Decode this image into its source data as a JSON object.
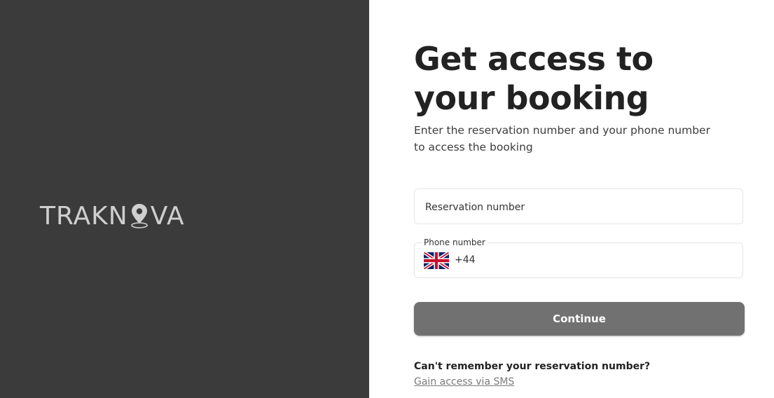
{
  "brand": {
    "logo_left": "TRAKN",
    "logo_right": "VA",
    "logo_color": "#cfcfcf",
    "panel_color": "#3b3b3b"
  },
  "main": {
    "title": "Get access to your booking",
    "subtitle": "Enter the reservation number and your phone number to access the booking"
  },
  "form": {
    "reservation": {
      "placeholder": "Reservation number",
      "value": ""
    },
    "phone": {
      "label": "Phone number",
      "country_flag": "uk-flag-icon",
      "country_code": "+44",
      "value": ""
    },
    "continue_label": "Continue",
    "button_color": "#717171"
  },
  "help": {
    "question": "Can't remember your reservation number?",
    "link_label": "Gain access via SMS"
  }
}
